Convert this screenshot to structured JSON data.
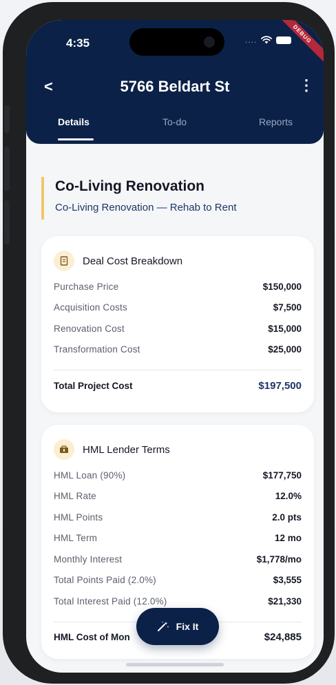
{
  "status_bar": {
    "time": "4:35",
    "signal_dots": "....",
    "debug_banner": "DEBUG"
  },
  "header": {
    "title": "5766 Beldart St",
    "back_label": "<",
    "more_label": "⋮",
    "tabs": [
      {
        "label": "Details",
        "active": true
      },
      {
        "label": "To-do",
        "active": false
      },
      {
        "label": "Reports",
        "active": false
      }
    ]
  },
  "project": {
    "name": "Co-Living Renovation",
    "subtitle": "Co-Living Renovation — Rehab to Rent"
  },
  "deal_cost": {
    "title": "Deal Cost Breakdown",
    "icon": "receipt-icon",
    "rows": [
      {
        "label": "Purchase Price",
        "value": "$150,000"
      },
      {
        "label": "Acquisition Costs",
        "value": "$7,500"
      },
      {
        "label": "Renovation Cost",
        "value": "$15,000"
      },
      {
        "label": "Transformation Cost",
        "value": "$25,000"
      }
    ],
    "total_label": "Total Project Cost",
    "total_value": "$197,500"
  },
  "hml_terms": {
    "title": "HML Lender Terms",
    "icon": "bank-icon",
    "rows": [
      {
        "label": "HML Loan (90%)",
        "value": "$177,750"
      },
      {
        "label": "HML Rate",
        "value": "12.0%"
      },
      {
        "label": "HML Points",
        "value": "2.0 pts"
      },
      {
        "label": "HML Term",
        "value": "12 mo"
      },
      {
        "label": "Monthly Interest",
        "value": "$1,778/mo"
      },
      {
        "label": "Total Points Paid (2.0%)",
        "value": "$3,555"
      },
      {
        "label": "Total Interest Paid (12.0%)",
        "value": "$21,330"
      }
    ],
    "total_label": "HML Cost of Mon",
    "total_value": "$24,885"
  },
  "fab": {
    "label": "Fix It",
    "icon": "magic-wand-icon"
  },
  "colors": {
    "header_bg": "#0b2148",
    "accent": "#f2c56b",
    "link_blue": "#1d3566",
    "debug": "#b3283a"
  }
}
